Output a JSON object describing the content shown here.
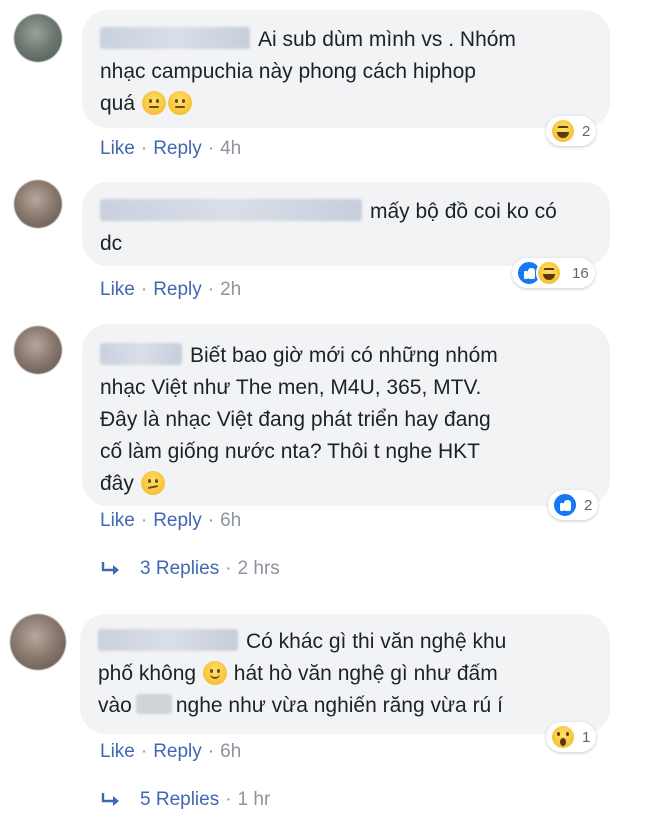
{
  "comments": [
    {
      "text_lines": [
        "Ai sub dùm mình vs . Nhóm",
        "nhạc campuchia này phong cách hiphop",
        "quá"
      ],
      "reaction_count": "2",
      "reaction_types": [
        "haha"
      ],
      "like_label": "Like",
      "reply_label": "Reply",
      "time": "4h"
    },
    {
      "text_lines": [
        "mấy bộ đồ coi ko có",
        "dc"
      ],
      "reaction_count": "16",
      "reaction_types": [
        "like",
        "haha"
      ],
      "like_label": "Like",
      "reply_label": "Reply",
      "time": "2h"
    },
    {
      "text_lines": [
        "Biết bao giờ mới có những nhóm",
        "nhạc Việt như The men, M4U, 365, MTV.",
        "Đây là nhạc Việt đang phát triển hay đang",
        "cố làm giống nước nta? Thôi t nghe HKT",
        "đây"
      ],
      "reaction_count": "2",
      "reaction_types": [
        "like"
      ],
      "like_label": "Like",
      "reply_label": "Reply",
      "time": "6h",
      "replies_label": "3 Replies",
      "replies_time": "2 hrs"
    },
    {
      "text_lines": [
        "Có khác gì thi văn nghệ khu",
        "phố không",
        "hát hò văn nghệ gì như đấm",
        "vào",
        "nghe như vừa nghiến răng vừa rú í"
      ],
      "reaction_count": "1",
      "reaction_types": [
        "wow"
      ],
      "like_label": "Like",
      "reply_label": "Reply",
      "time": "6h",
      "replies_label": "5 Replies",
      "replies_time": "1 hr"
    }
  ],
  "colors": {
    "bubble": "#f2f3f5",
    "link": "#4267b2",
    "meta": "#8d949e",
    "text": "#1d2129"
  }
}
